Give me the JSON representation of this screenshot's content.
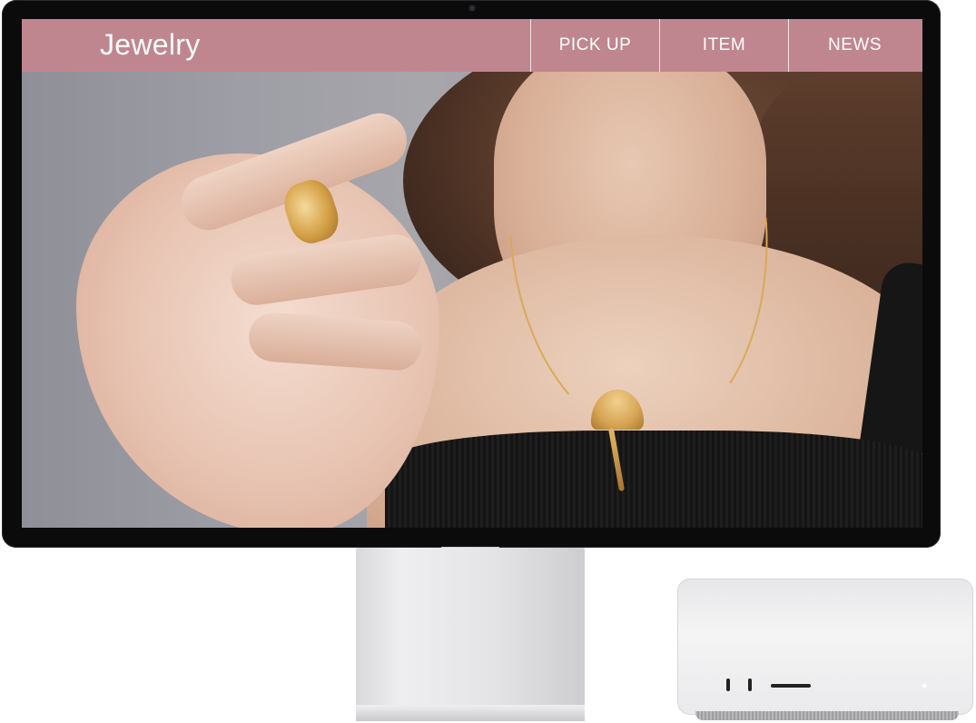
{
  "site": {
    "brand": "Jewelry",
    "header_color": "#c0868f",
    "nav": [
      {
        "label": "PICK UP"
      },
      {
        "label": "ITEM"
      },
      {
        "label": "NEWS"
      }
    ]
  },
  "hero": {
    "image_subject": "woman-wearing-gold-ginkgo-necklace-and-ring"
  },
  "icons": [
    "webcam-icon"
  ],
  "colors": {
    "accent": "#c0868f",
    "bezel": "#0b0b0c",
    "device_silver": "#e7e7e9"
  }
}
